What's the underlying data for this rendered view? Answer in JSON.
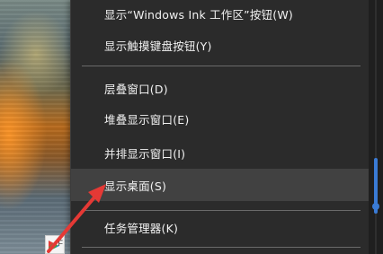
{
  "context_menu": {
    "items": [
      {
        "label": "显示“Windows Ink 工作区”按钮(W)"
      },
      {
        "label": "显示触摸键盘按钮(Y)"
      },
      {
        "label": "层叠窗口(D)"
      },
      {
        "label": "堆叠显示窗口(E)"
      },
      {
        "label": "并排显示窗口(I)"
      },
      {
        "label": "显示桌面(S)",
        "highlighted": true
      },
      {
        "label": "任务管理器(K)"
      }
    ]
  },
  "taskbar": {
    "app_icon_letter": "F"
  },
  "annotation": {
    "arrow_color": "#e53935"
  }
}
